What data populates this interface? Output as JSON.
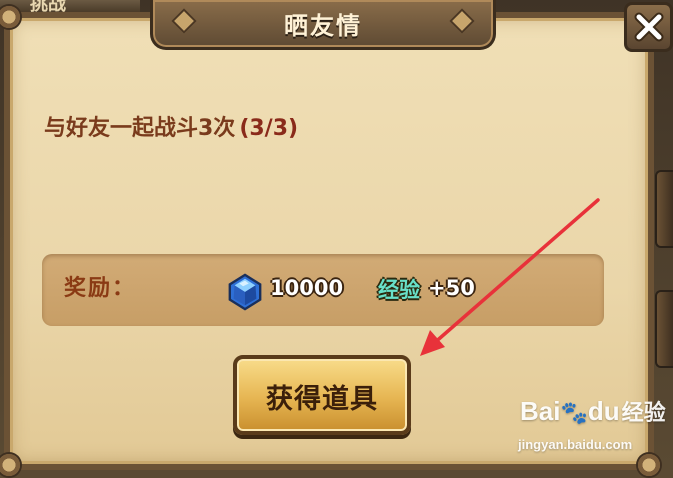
{
  "window": {
    "prev_tab": "挑战",
    "title": "晒友情"
  },
  "task": {
    "description": "与好友一起战斗3次",
    "progress": "(3/3)"
  },
  "reward": {
    "label": "奖励：",
    "gem_amount": "10000",
    "exp_label": "经验",
    "exp_amount": "+50"
  },
  "actions": {
    "get_button": "获得道具"
  },
  "watermark": {
    "logo": "Bai",
    "logo2": "du",
    "brand_cn": "经验",
    "url": "jingyan.baidu.com"
  },
  "colors": {
    "panel_bg": "#ead6a9",
    "frame": "#6b5235",
    "task_text": "#7a3b1c",
    "reward_box": "#cca26b",
    "exp_color": "#68e0c8",
    "arrow": "#e8323a"
  },
  "icons": [
    "close-icon",
    "gem-icon",
    "annotation-arrow"
  ]
}
